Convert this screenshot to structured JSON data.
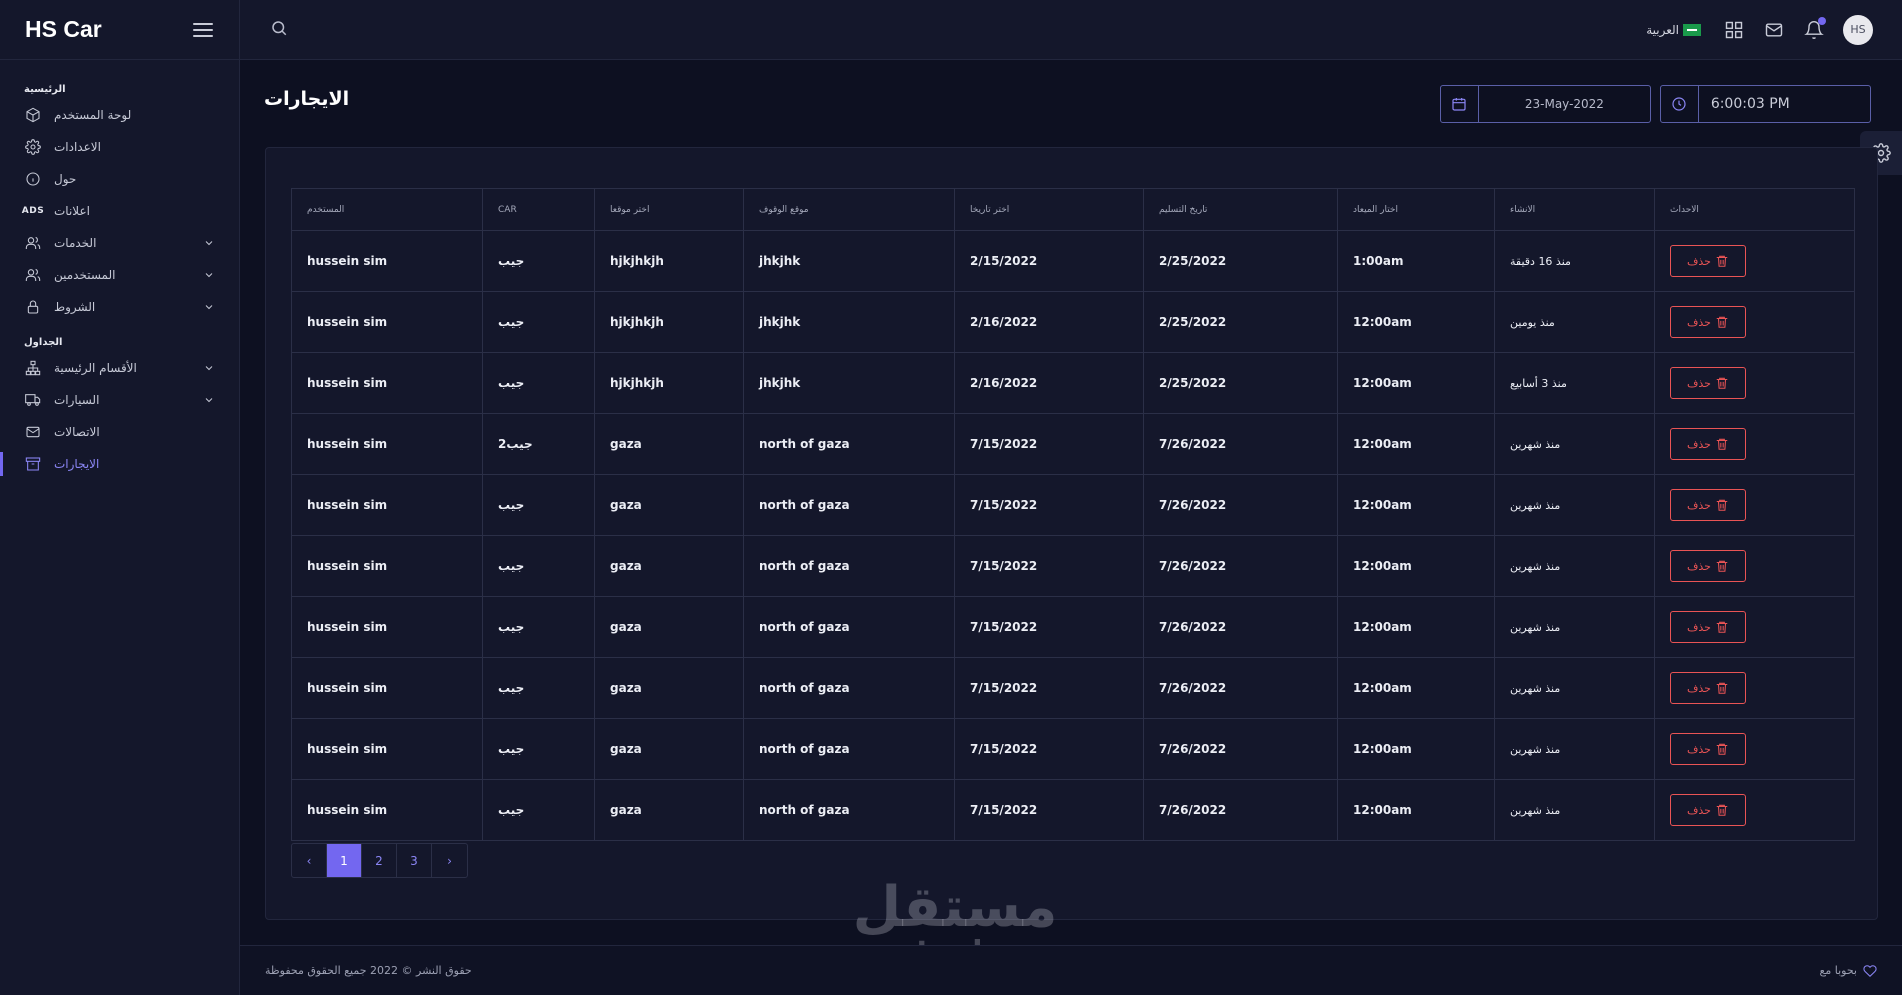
{
  "brand": {
    "title": "HS Car"
  },
  "sidebar": {
    "sections": [
      {
        "label": "الرئيسية"
      },
      {
        "label": "الجداول"
      }
    ],
    "items": [
      {
        "label": "لوحة المستخدم",
        "icon": "cube-icon"
      },
      {
        "label": "الاعدادات",
        "icon": "gear-icon"
      },
      {
        "label": "حول",
        "icon": "info-icon"
      },
      {
        "label": "اعلانات",
        "icon": "ads-icon",
        "tag": "ADS"
      },
      {
        "label": "الخدمات",
        "icon": "users-icon"
      },
      {
        "label": "المستخدمين",
        "icon": "users-icon"
      },
      {
        "label": "الشروط",
        "icon": "lock-icon"
      },
      {
        "label": "الأقسام الرئيسية",
        "icon": "sitemap-icon"
      },
      {
        "label": "السيارات",
        "icon": "truck-icon"
      },
      {
        "label": "الاتصالات",
        "icon": "mail-icon"
      },
      {
        "label": "الايجارات",
        "icon": "archive-icon"
      }
    ]
  },
  "header": {
    "language": "العربية"
  },
  "avatar": {
    "initials": "HS"
  },
  "page": {
    "title": "الايجارات",
    "date": "23-May-2022",
    "time": "6:00:03 PM"
  },
  "table": {
    "headers": [
      "المستخدم",
      "CAR",
      "اختر موقعا",
      "موقع الوقوف",
      "اختر تاريخا",
      "تاريخ التسليم",
      "اختار الميعاد",
      "الانشاء",
      "الاحداث"
    ],
    "delete_label": "حذف",
    "rows": [
      [
        "hussein sim",
        "جيب",
        "hjkjhkjh",
        "jhkjhk",
        "2/15/2022",
        "2/25/2022",
        "1:00am",
        "منذ 16 دقيقة"
      ],
      [
        "hussein sim",
        "جيب",
        "hjkjhkjh",
        "jhkjhk",
        "2/16/2022",
        "2/25/2022",
        "12:00am",
        "منذ يومين"
      ],
      [
        "hussein sim",
        "جيب",
        "hjkjhkjh",
        "jhkjhk",
        "2/16/2022",
        "2/25/2022",
        "12:00am",
        "منذ 3 أسابيع"
      ],
      [
        "hussein sim",
        "جيب2",
        "gaza",
        "north of gaza",
        "7/15/2022",
        "7/26/2022",
        "12:00am",
        "منذ شهرين"
      ],
      [
        "hussein sim",
        "جيب",
        "gaza",
        "north of gaza",
        "7/15/2022",
        "7/26/2022",
        "12:00am",
        "منذ شهرين"
      ],
      [
        "hussein sim",
        "جيب",
        "gaza",
        "north of gaza",
        "7/15/2022",
        "7/26/2022",
        "12:00am",
        "منذ شهرين"
      ],
      [
        "hussein sim",
        "جيب",
        "gaza",
        "north of gaza",
        "7/15/2022",
        "7/26/2022",
        "12:00am",
        "منذ شهرين"
      ],
      [
        "hussein sim",
        "جيب",
        "gaza",
        "north of gaza",
        "7/15/2022",
        "7/26/2022",
        "12:00am",
        "منذ شهرين"
      ],
      [
        "hussein sim",
        "جيب",
        "gaza",
        "north of gaza",
        "7/15/2022",
        "7/26/2022",
        "12:00am",
        "منذ شهرين"
      ],
      [
        "hussein sim",
        "جيب",
        "gaza",
        "north of gaza",
        "7/15/2022",
        "7/26/2022",
        "12:00am",
        "منذ شهرين"
      ]
    ]
  },
  "pagination": {
    "prev": "‹",
    "pages": [
      "1",
      "2",
      "3"
    ],
    "next": "›",
    "current": "1"
  },
  "footer": {
    "copyright": "حقوق النشر © 2022 جميع الحقوق محفوظة",
    "made_with": "بحوبا مع"
  },
  "watermark": {
    "arabic": "مستقل",
    "latin": "mostaql.com"
  },
  "colors": {
    "accent": "#7367f0",
    "danger": "#ea5455",
    "background": "#0d1021",
    "panel": "#14172b"
  }
}
